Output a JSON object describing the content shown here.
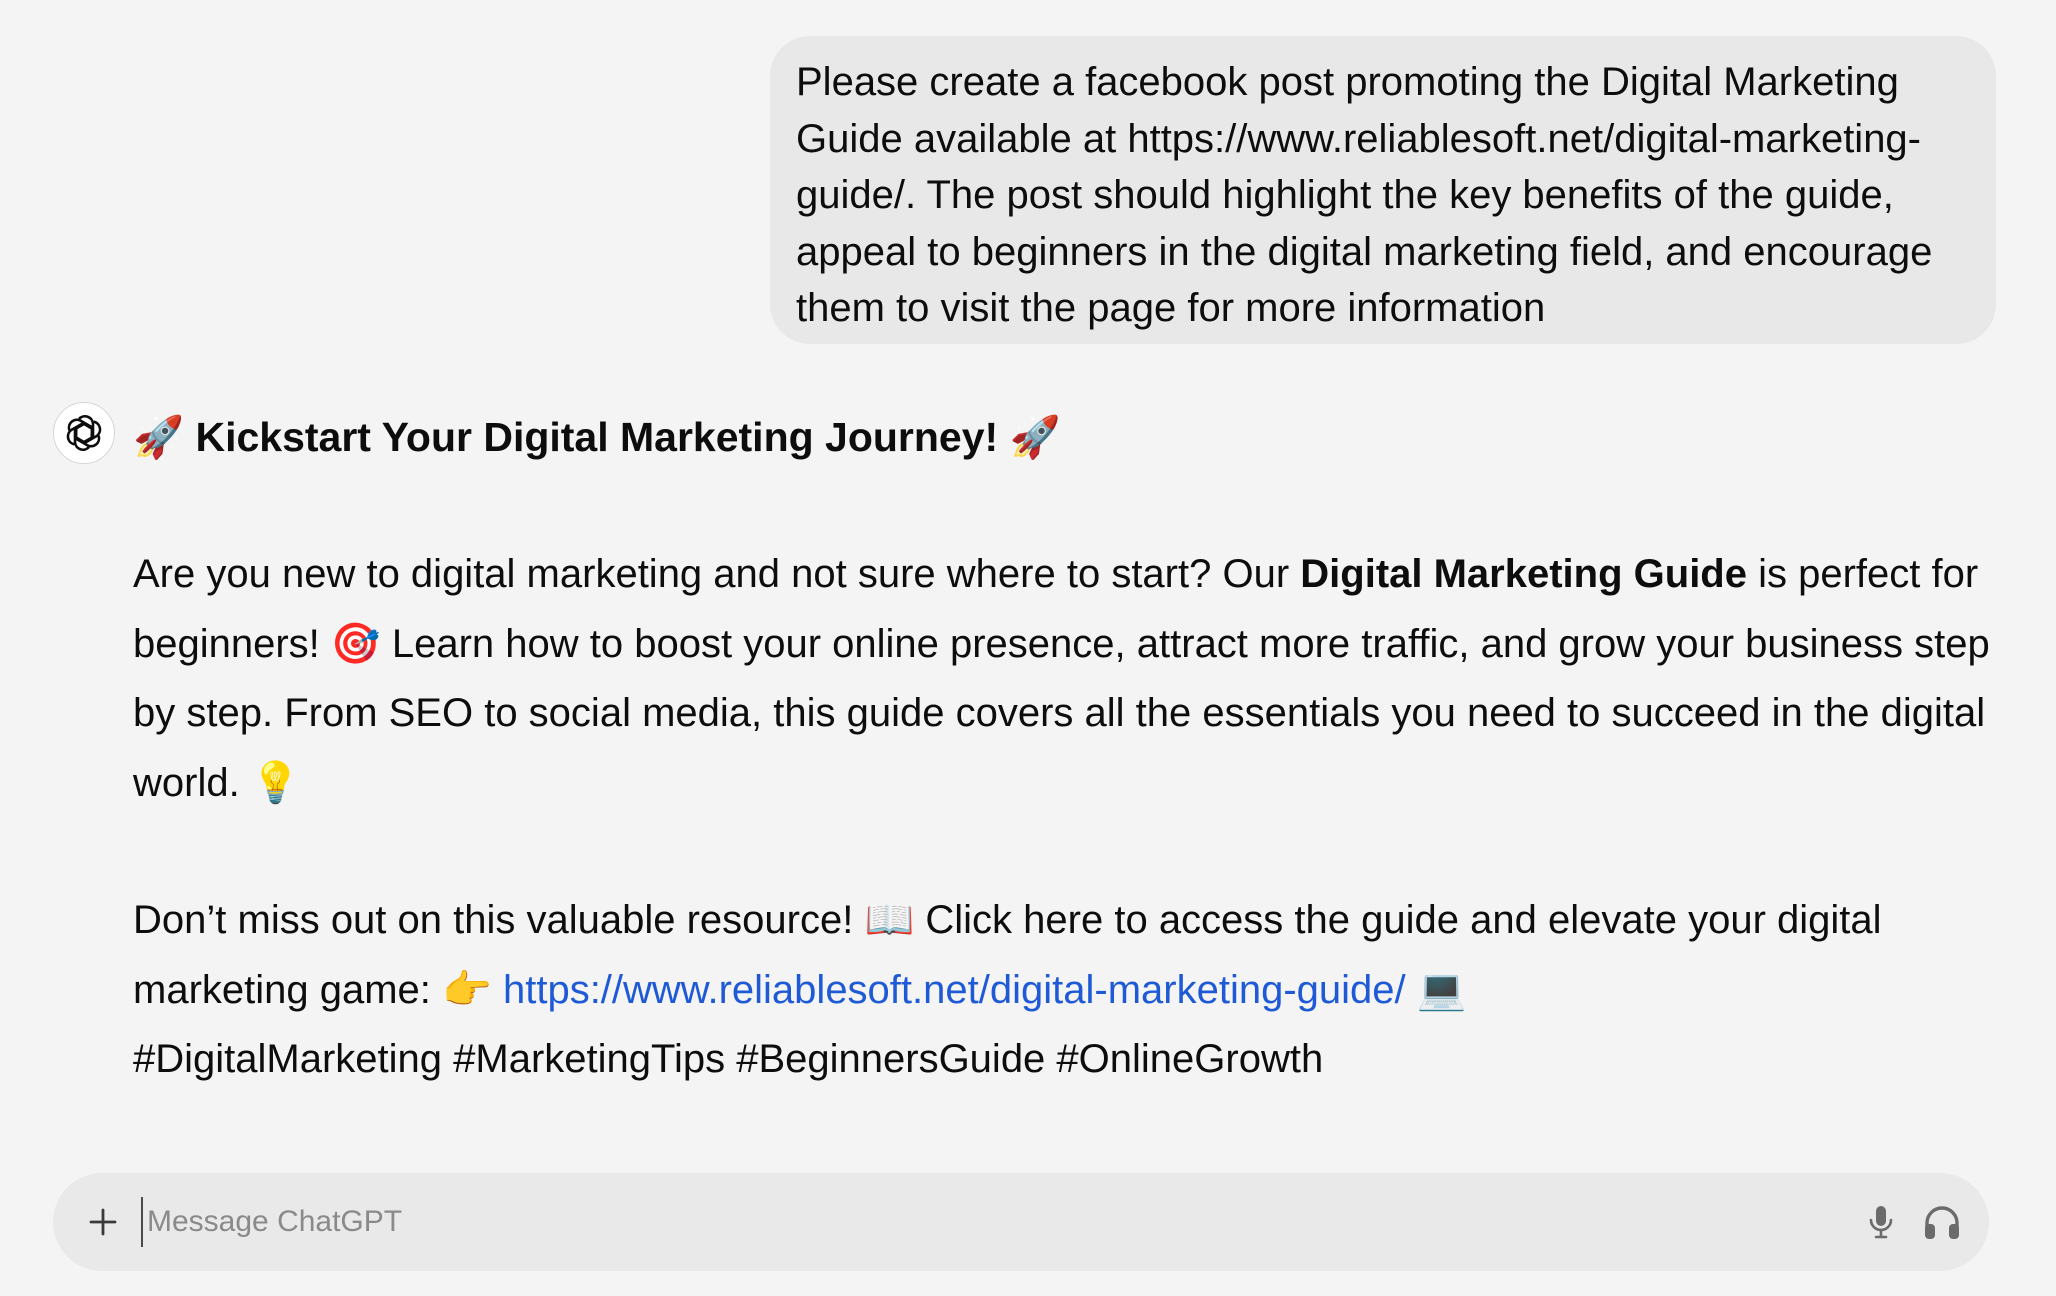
{
  "conversation": {
    "user_message": "Please create a facebook post promoting the Digital Marketing Guide available at https://www.reliablesoft.net/digital-marketing-guide/. The post should highlight the key benefits of the guide, appeal to beginners in the digital marketing field, and encourage them to visit the page for more information",
    "assistant": {
      "avatar_icon": "openai-logo-icon",
      "headline_emoji_left": "🚀",
      "headline": "Kickstart Your Digital Marketing Journey!",
      "headline_emoji_right": "🚀",
      "para1_part1": "Are you new to digital marketing and not sure where to start? Our ",
      "para1_bold": "Digital Marketing Guide",
      "para1_part2": " is perfect for beginners! ",
      "para1_emoji_target": "🎯",
      "para1_part3": " Learn how to boost your online presence, attract more traffic, and grow your business step by step. From SEO to social media, this guide covers all the essentials you need to succeed in the digital world. ",
      "para1_emoji_bulb": "💡",
      "para2_part1": "Don’t miss out on this valuable resource! ",
      "para2_emoji_book": "📖",
      "para2_part2": " Click here to access the guide and elevate your digital marketing game: ",
      "para2_emoji_point": "👉",
      "link_text": "https://www.reliablesoft.net/digital-marketing-guide/",
      "para2_emoji_laptop": "💻",
      "hashtags": "#DigitalMarketing #MarketingTips #BeginnersGuide #OnlineGrowth"
    }
  },
  "composer": {
    "placeholder": "Message ChatGPT",
    "value": "",
    "icons": [
      "plus-icon",
      "microphone-icon",
      "headphones-icon"
    ]
  },
  "colors": {
    "background": "#f4f4f4",
    "user_bubble": "#e8e8e8",
    "composer": "#e9e9e9",
    "link": "#1f5ad6"
  }
}
